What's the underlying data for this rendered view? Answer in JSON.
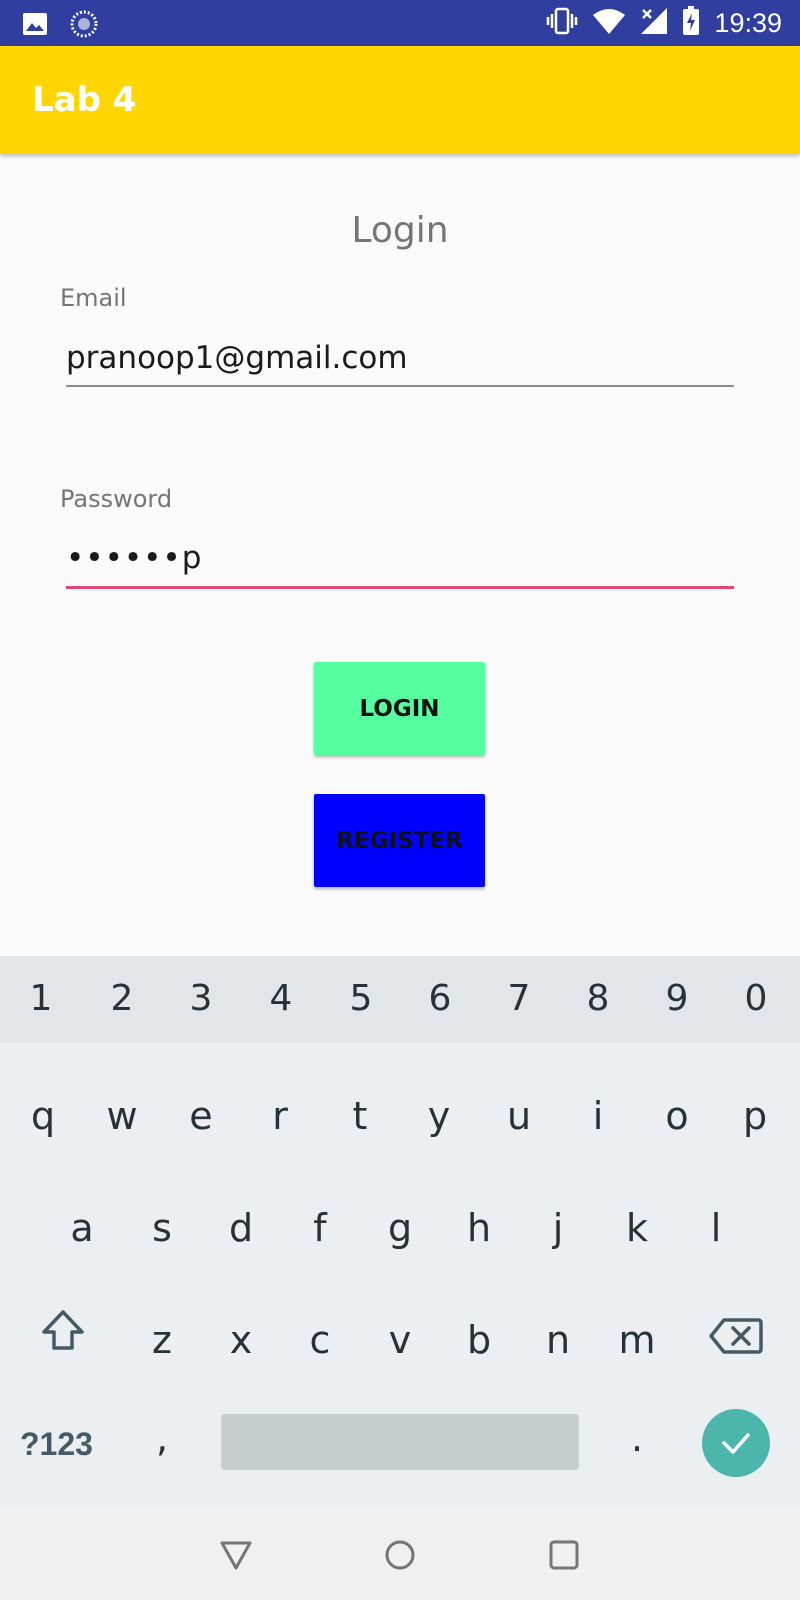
{
  "status_bar": {
    "time": "19:39",
    "icons": [
      "image-icon",
      "sync-icon",
      "vibrate-icon",
      "wifi-icon",
      "signal-icon",
      "battery-charging-icon"
    ]
  },
  "app_bar": {
    "title": "Lab 4",
    "background": "#ffd600"
  },
  "form": {
    "heading": "Login",
    "email_label": "Email",
    "email_value": "pranoop1@gmail.com",
    "password_label": "Password",
    "password_value": "••••••p",
    "accent_color": "#e0457b"
  },
  "buttons": {
    "login_label": "LOGIN",
    "login_color": "#55ff9f",
    "register_label": "REGISTER",
    "register_color": "#0000ff"
  },
  "keyboard": {
    "number_row": [
      "1",
      "2",
      "3",
      "4",
      "5",
      "6",
      "7",
      "8",
      "9",
      "0"
    ],
    "row1": [
      "q",
      "w",
      "e",
      "r",
      "t",
      "y",
      "u",
      "i",
      "o",
      "p"
    ],
    "row2": [
      "a",
      "s",
      "d",
      "f",
      "g",
      "h",
      "j",
      "k",
      "l"
    ],
    "row3": [
      "z",
      "x",
      "c",
      "v",
      "b",
      "n",
      "m"
    ],
    "symbols_label": "?123",
    "comma_label": ",",
    "period_label": ".",
    "icons": [
      "shift-icon",
      "backspace-icon",
      "enter-check-icon"
    ]
  },
  "nav_bar": {
    "icons": [
      "back-icon",
      "home-icon",
      "recents-icon"
    ]
  }
}
